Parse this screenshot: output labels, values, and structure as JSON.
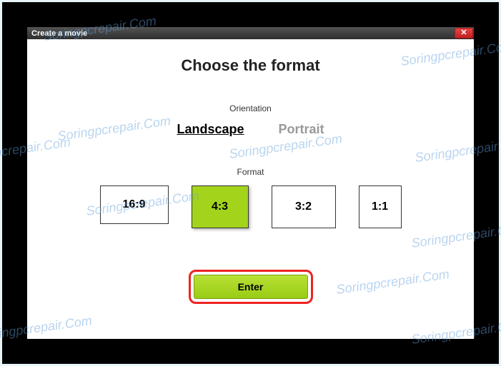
{
  "titlebar": {
    "title": "Create a movie"
  },
  "dialog": {
    "heading": "Choose the format",
    "orientation_label": "Orientation",
    "orientation": {
      "landscape": "Landscape",
      "portrait": "Portrait",
      "selected": "landscape"
    },
    "format_label": "Format",
    "formats": {
      "f0": "16:9",
      "f1": "4:3",
      "f2": "3:2",
      "f3": "1:1",
      "selected": "4:3"
    },
    "enter_label": "Enter"
  },
  "watermark_text": "Soringpcrepair.Com"
}
